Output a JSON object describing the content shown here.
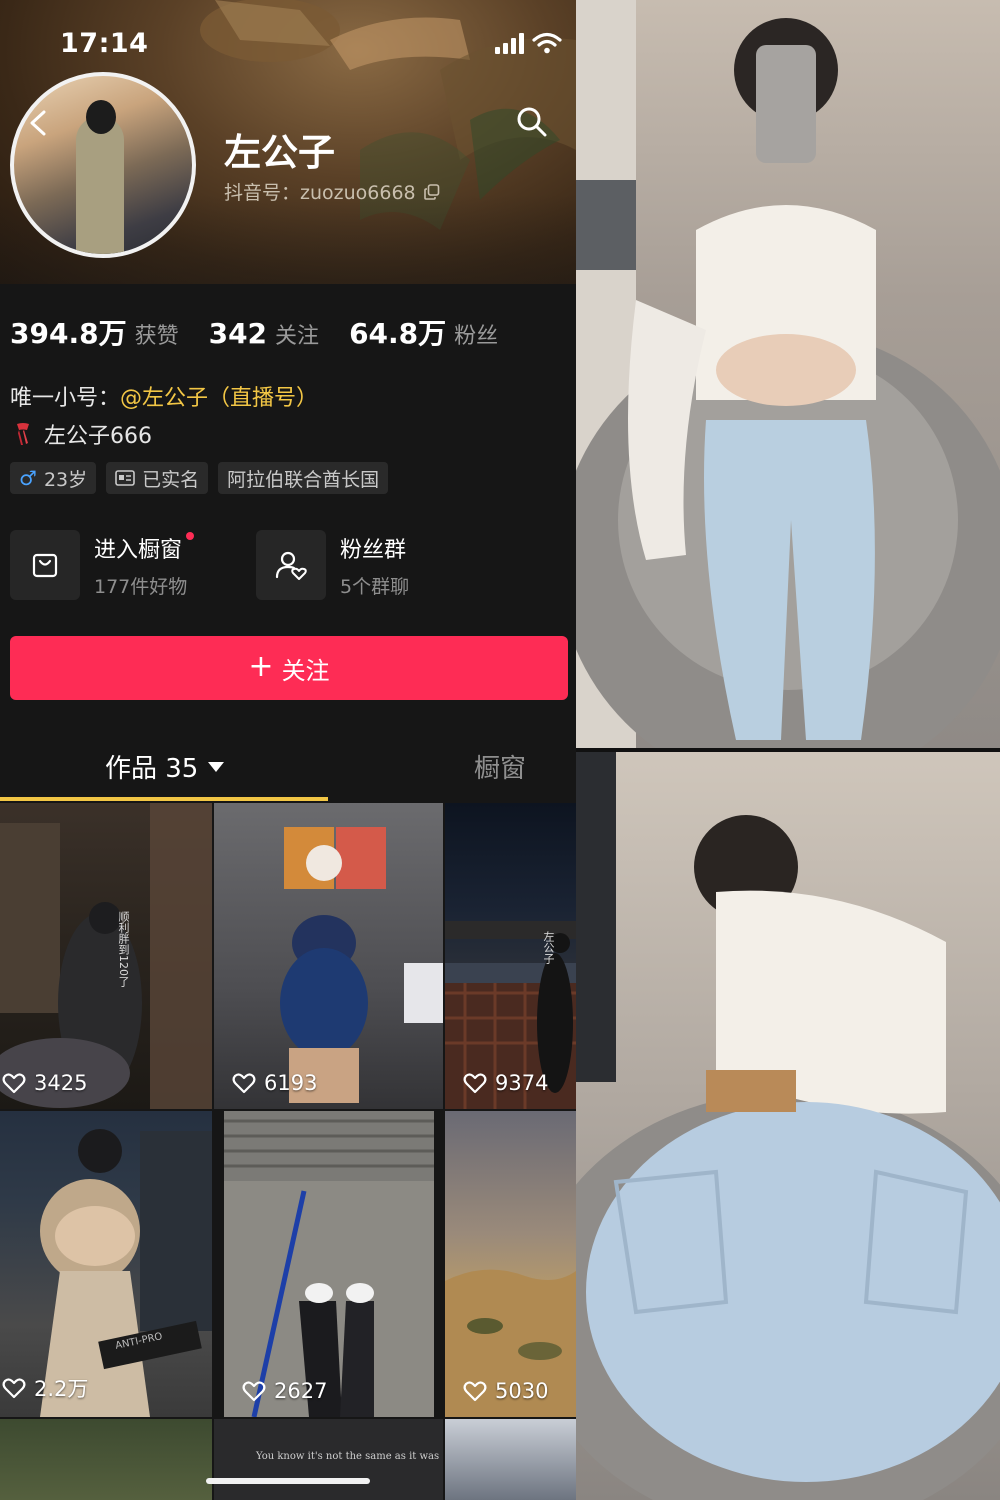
{
  "status_bar": {
    "time": "17:14"
  },
  "profile": {
    "name": "左公子",
    "douyin_id": "抖音号：zuozuo6668"
  },
  "stats": [
    {
      "value": "394.8万",
      "label": "获赞"
    },
    {
      "value": "342",
      "label": "关注"
    },
    {
      "value": "64.8万",
      "label": "粉丝"
    }
  ],
  "bio": {
    "line1_prefix": "唯一小号：",
    "line1_mention": "@左公子（直播号）",
    "line2": "左公子666"
  },
  "tags": {
    "male_symbol": "♂",
    "age": "23岁",
    "verified": "已实名",
    "location": "阿拉伯联合酋长国"
  },
  "quick_links": {
    "shop_title": "进入橱窗",
    "shop_sub": "177件好物",
    "group_title": "粉丝群",
    "group_sub": "5个群聊"
  },
  "follow_button": {
    "plus": "+",
    "label": "关注"
  },
  "tabs": {
    "works": "作品 35",
    "shop": "橱窗"
  },
  "videos": [
    {
      "likes": "3425"
    },
    {
      "likes": "6193"
    },
    {
      "likes": "9374"
    },
    {
      "likes": "2.2万"
    },
    {
      "likes": "2627"
    },
    {
      "likes": "5030"
    }
  ],
  "video_captions": {
    "cell1": "顺利胖到120了",
    "cell3": "左公子",
    "cell4": "ANTI-PRO",
    "cell8": "You know it's not the same as it was"
  },
  "colors": {
    "accent": "#fe2c55",
    "mention": "#f2c645",
    "background": "#161616"
  }
}
